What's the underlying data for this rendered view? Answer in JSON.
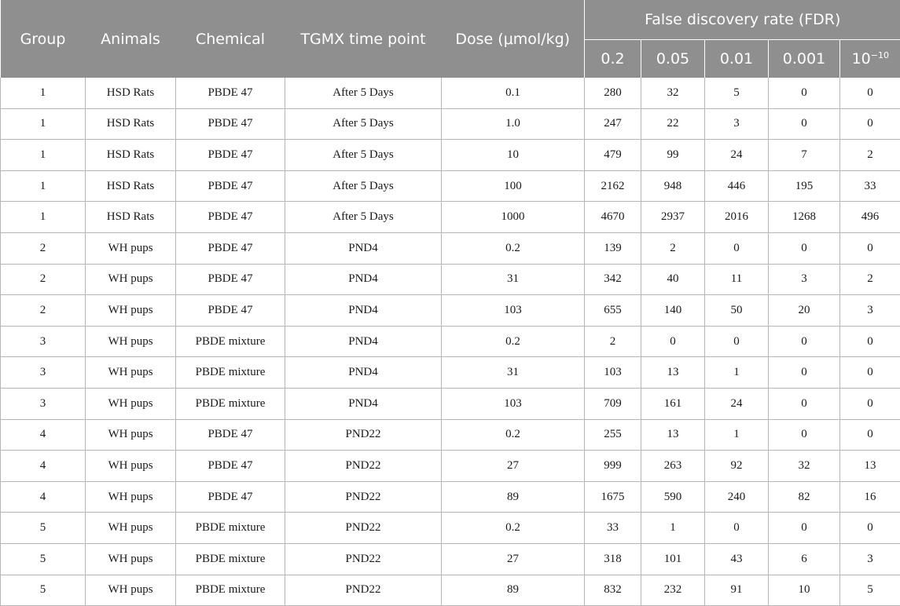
{
  "header": {
    "fdr_group": "False discovery rate (FDR)",
    "columns": [
      "Group",
      "Animals",
      "Chemical",
      "TGMX time point",
      "Dose (μmol/kg)"
    ],
    "fdr_columns": [
      "0.2",
      "0.05",
      "0.01",
      "0.001"
    ],
    "fdr_last_base": "10",
    "fdr_last_exp": "−10"
  },
  "rows": [
    [
      "1",
      "HSD Rats",
      "PBDE 47",
      "After 5 Days",
      "0.1",
      "280",
      "32",
      "5",
      "0",
      "0"
    ],
    [
      "1",
      "HSD Rats",
      "PBDE 47",
      "After 5 Days",
      "1.0",
      "247",
      "22",
      "3",
      "0",
      "0"
    ],
    [
      "1",
      "HSD Rats",
      "PBDE 47",
      "After 5 Days",
      "10",
      "479",
      "99",
      "24",
      "7",
      "2"
    ],
    [
      "1",
      "HSD Rats",
      "PBDE 47",
      "After 5 Days",
      "100",
      "2162",
      "948",
      "446",
      "195",
      "33"
    ],
    [
      "1",
      "HSD Rats",
      "PBDE 47",
      "After 5 Days",
      "1000",
      "4670",
      "2937",
      "2016",
      "1268",
      "496"
    ],
    [
      "2",
      "WH pups",
      "PBDE 47",
      "PND4",
      "0.2",
      "139",
      "2",
      "0",
      "0",
      "0"
    ],
    [
      "2",
      "WH pups",
      "PBDE 47",
      "PND4",
      "31",
      "342",
      "40",
      "11",
      "3",
      "2"
    ],
    [
      "2",
      "WH pups",
      "PBDE 47",
      "PND4",
      "103",
      "655",
      "140",
      "50",
      "20",
      "3"
    ],
    [
      "3",
      "WH pups",
      "PBDE mixture",
      "PND4",
      "0.2",
      "2",
      "0",
      "0",
      "0",
      "0"
    ],
    [
      "3",
      "WH pups",
      "PBDE mixture",
      "PND4",
      "31",
      "103",
      "13",
      "1",
      "0",
      "0"
    ],
    [
      "3",
      "WH pups",
      "PBDE mixture",
      "PND4",
      "103",
      "709",
      "161",
      "24",
      "0",
      "0"
    ],
    [
      "4",
      "WH pups",
      "PBDE 47",
      "PND22",
      "0.2",
      "255",
      "13",
      "1",
      "0",
      "0"
    ],
    [
      "4",
      "WH pups",
      "PBDE 47",
      "PND22",
      "27",
      "999",
      "263",
      "92",
      "32",
      "13"
    ],
    [
      "4",
      "WH pups",
      "PBDE 47",
      "PND22",
      "89",
      "1675",
      "590",
      "240",
      "82",
      "16"
    ],
    [
      "5",
      "WH pups",
      "PBDE mixture",
      "PND22",
      "0.2",
      "33",
      "1",
      "0",
      "0",
      "0"
    ],
    [
      "5",
      "WH pups",
      "PBDE mixture",
      "PND22",
      "27",
      "318",
      "101",
      "43",
      "6",
      "3"
    ],
    [
      "5",
      "WH pups",
      "PBDE mixture",
      "PND22",
      "89",
      "832",
      "232",
      "91",
      "10",
      "5"
    ]
  ]
}
